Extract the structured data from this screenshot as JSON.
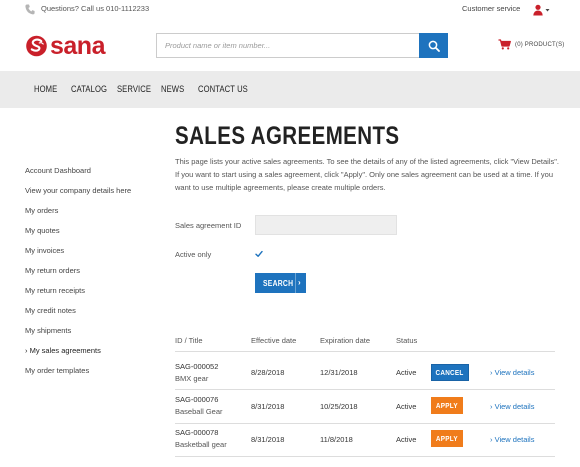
{
  "topbar": {
    "phone_text": "Questions? Call us 010-1112233",
    "customer_service": "Customer service",
    "user_icon": "user-icon"
  },
  "header": {
    "logo_text": "sana",
    "search_placeholder": "Product name or item number...",
    "cart_count": "(0) PRODUCT(S)"
  },
  "nav": {
    "items": [
      "HOME",
      "CATALOG",
      "SERVICE",
      "NEWS",
      "CONTACT US"
    ]
  },
  "sidebar": {
    "items": [
      "Account Dashboard",
      "View your company details here",
      "My orders",
      "My quotes",
      "My invoices",
      "My return orders",
      "My return receipts",
      "My credit notes",
      "My shipments",
      "› My sales agreements",
      "My order templates"
    ],
    "active_index": 9
  },
  "main": {
    "title": "SALES AGREEMENTS",
    "description": "This page lists your active sales agreements. To see the details of any of the listed agreements, click \"View Details\". If you want to start using a sales agreement, click \"Apply\". Only one sales agreement can be used at a time. If you want to use multiple agreements, please create multiple orders.",
    "filter": {
      "id_label": "Sales agreement ID",
      "id_value": "",
      "active_label": "Active only",
      "active_checked": true,
      "search_label": "SEARCH",
      "search_arrow": "›"
    },
    "table": {
      "headers": [
        "ID / Title",
        "Effective date",
        "Expiration date",
        "Status"
      ],
      "rows": [
        {
          "id": "SAG-000052",
          "title": "BMX gear",
          "effective": "8/28/2018",
          "expiration": "12/31/2018",
          "status": "Active",
          "action": "CANCEL",
          "details": "› View details"
        },
        {
          "id": "SAG-000076",
          "title": "Baseball Gear",
          "effective": "8/31/2018",
          "expiration": "10/25/2018",
          "status": "Active",
          "action": "APPLY",
          "details": "› View details"
        },
        {
          "id": "SAG-000078",
          "title": "Basketball gear",
          "effective": "8/31/2018",
          "expiration": "11/8/2018",
          "status": "Active",
          "action": "APPLY",
          "details": "› View details"
        }
      ]
    }
  },
  "colors": {
    "brand_red": "#c9202a",
    "primary_blue": "#1e73be",
    "apply_orange": "#f07c1b",
    "nav_bg": "#ebebeb"
  }
}
